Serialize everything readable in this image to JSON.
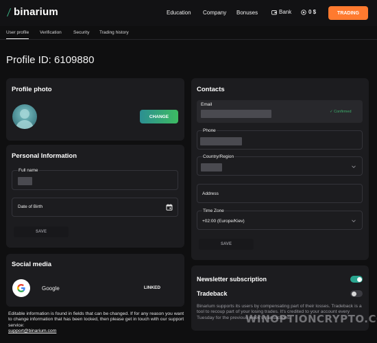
{
  "header": {
    "logo_text": "binarium",
    "nav": [
      "Education",
      "Company",
      "Bonuses"
    ],
    "bank_label": "Bank",
    "balance": "0 $",
    "trading_button": "TRADING"
  },
  "subnav": {
    "tabs": [
      "User profile",
      "Verification",
      "Security",
      "Trading history"
    ],
    "active_index": 0
  },
  "profile_id": "Profile ID: 6109880",
  "profile_photo": {
    "title": "Profile photo",
    "change_button": "CHANGE"
  },
  "personal_info": {
    "title": "Personal Information",
    "full_name_label": "Full name",
    "dob_label": "Date of Birth",
    "save_button": "SAVE"
  },
  "social_media": {
    "title": "Social media",
    "provider": "Google",
    "linked_button": "LINKED"
  },
  "note": {
    "text": "Editable information is found in fields that can be changed. If for any reason you want to change information that has been locked, then please get in touch with our support service:",
    "email": "support@binarium.com"
  },
  "contacts": {
    "title": "Contacts",
    "email_label": "Email",
    "email_status": "✓ Confirmed",
    "phone_label": "Phone",
    "country_label": "Country/Region",
    "address_label": "Address",
    "timezone_label": "Time Zone",
    "timezone_value": "+02:00 (Europe/Kiev)",
    "save_button": "SAVE"
  },
  "newsletter": {
    "newsletter_label": "Newsletter subscription",
    "newsletter_on": true,
    "tradeback_label": "Tradeback",
    "tradeback_on": false,
    "tradeback_text": "Binarium supports its users by compensating part of their losses. Tradeback is a tool to recoup part of your losing trades. It's credited to your account every Tuesday for the previous week's transactions."
  },
  "watermark": "WINOPTIONCRYPTO.COM",
  "colors": {
    "accent_orange": "#ff7a2f",
    "toggle_on": "#2aa58f",
    "confirmed_green": "#3db26d",
    "background": "#0f0f10",
    "card": "#1c1c1f"
  }
}
